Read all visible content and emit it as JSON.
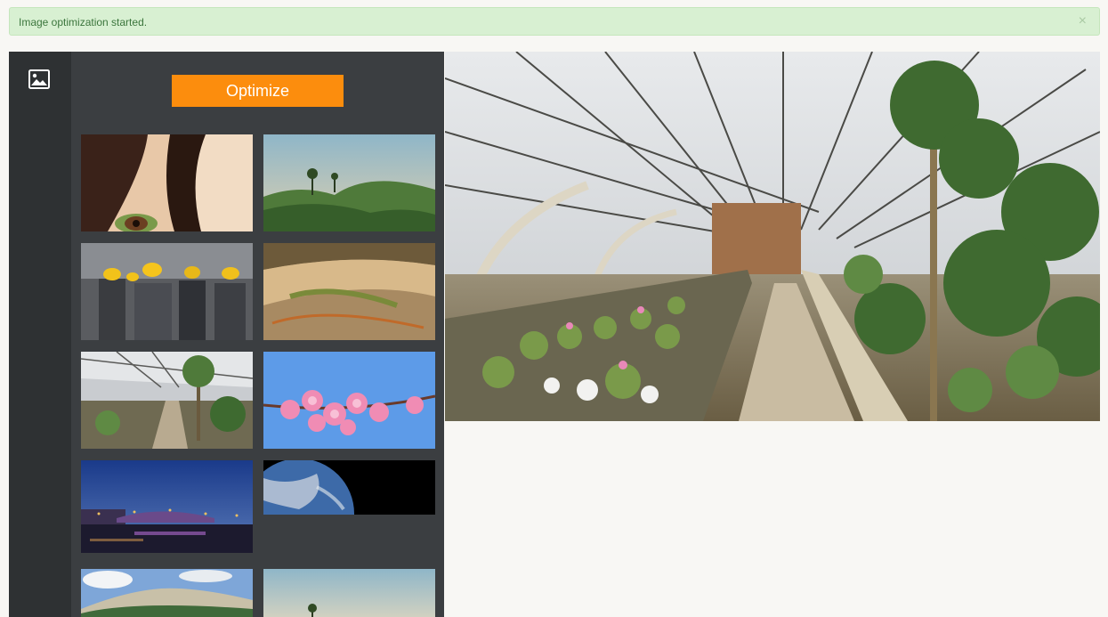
{
  "alert": {
    "message": "Image optimization started.",
    "close_symbol": "×",
    "bg_color": "#d8f0d2",
    "text_color": "#3c763d"
  },
  "sidebar": {
    "icon": "image-icon"
  },
  "panel": {
    "button_label": "Optimize",
    "button_color": "#fc8d0d",
    "thumbnails": [
      {
        "subject": "woman-eye"
      },
      {
        "subject": "tropical-hills"
      },
      {
        "subject": "construction-workers"
      },
      {
        "subject": "aerial-landscape"
      },
      {
        "subject": "greenhouse"
      },
      {
        "subject": "cherry-blossom"
      },
      {
        "subject": "bridge-at-night"
      },
      {
        "subject": "earth-from-space"
      },
      {
        "subject": "cliff-forest"
      },
      {
        "subject": "tropical-hills"
      }
    ]
  },
  "preview": {
    "subject": "greenhouse"
  }
}
